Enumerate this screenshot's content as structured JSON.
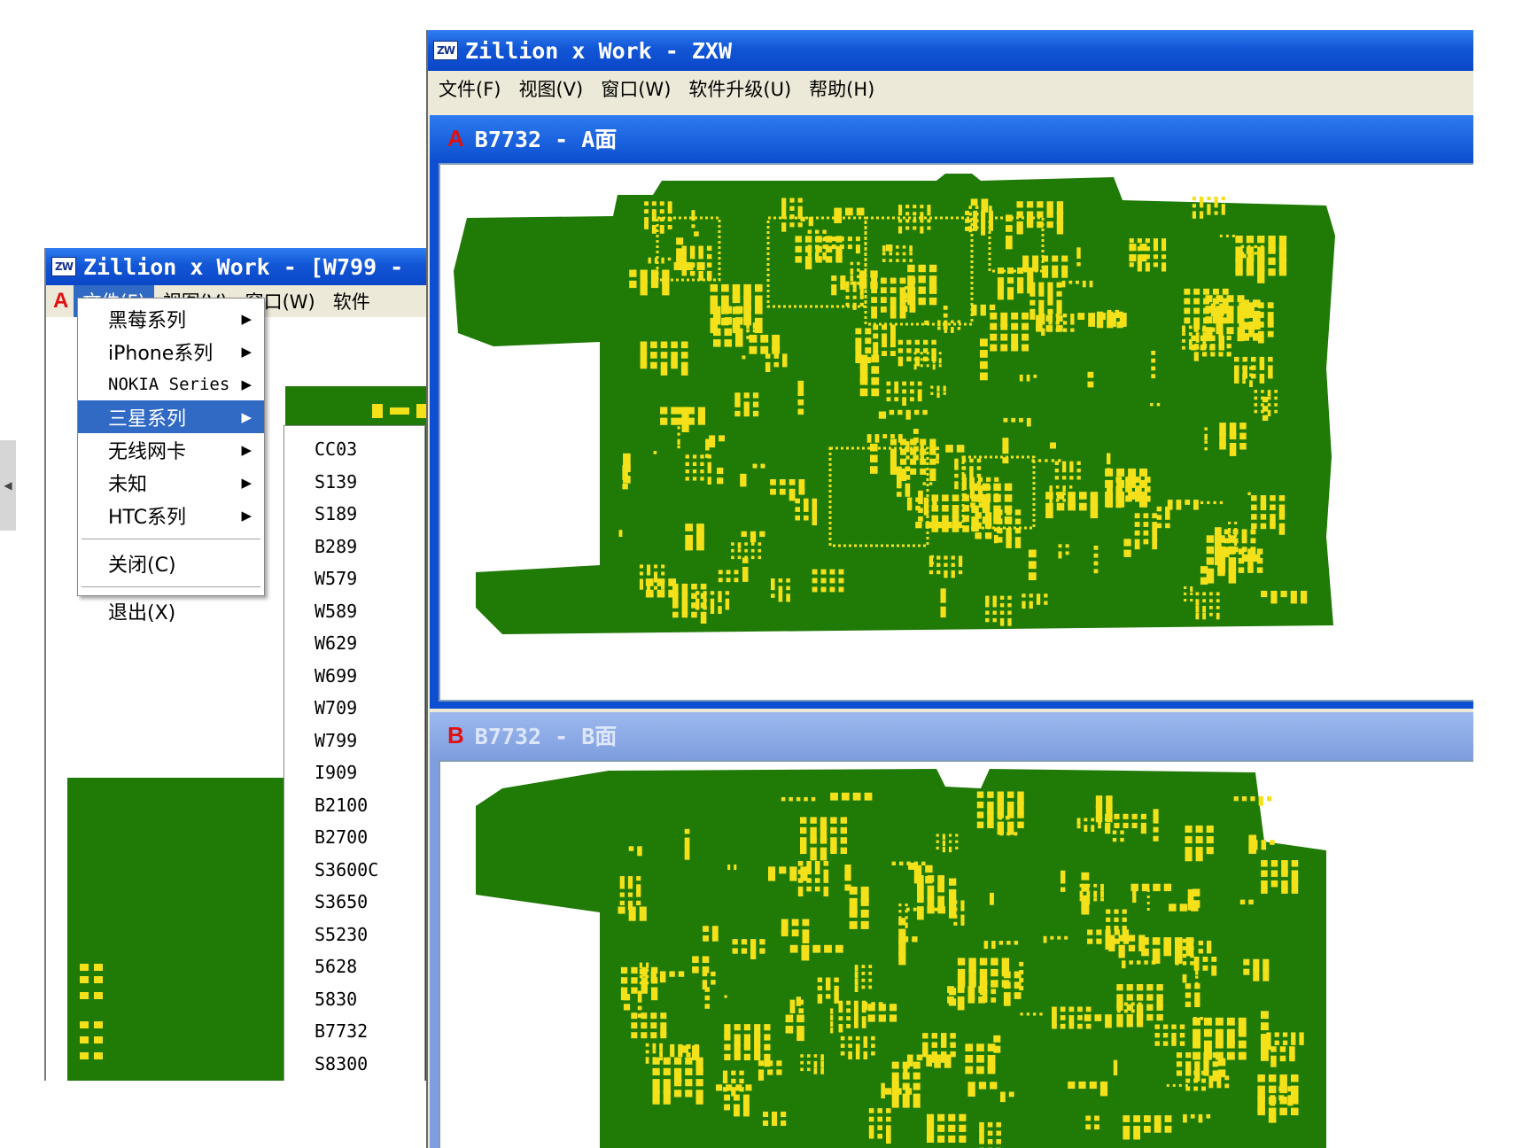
{
  "left_window": {
    "title": "Zillion x Work - [W799 -",
    "icon": "ZW",
    "mdi_icon": "A",
    "menu": [
      "文件(F)",
      "视图(V)",
      "窗口(W)",
      "软件"
    ],
    "file_menu": {
      "items": [
        {
          "label": "黑莓系列",
          "submenu": true
        },
        {
          "label": "iPhone系列",
          "submenu": true
        },
        {
          "label": "NOKIA Series",
          "submenu": true
        },
        {
          "label": "三星系列",
          "submenu": true,
          "highlighted": true
        },
        {
          "label": "无线网卡",
          "submenu": true
        },
        {
          "label": "未知",
          "submenu": true
        },
        {
          "label": "HTC系列",
          "submenu": true
        }
      ],
      "close_label": "关闭(C)",
      "exit_label": "退出(X)"
    },
    "samsung_submenu": [
      "CC03",
      "S139",
      "S189",
      "B289",
      "W579",
      "W589",
      "W629",
      "W699",
      "W709",
      "W799",
      "I909",
      "B2100",
      "B2700",
      "S3600C",
      "S3650",
      "S5230",
      "5628",
      "5830",
      "B7732",
      "S8300"
    ]
  },
  "right_window": {
    "title": "Zillion x Work - ZXW",
    "icon": "ZW",
    "menu": [
      "文件(F)",
      "视图(V)",
      "窗口(W)",
      "软件升级(U)",
      "帮助(H)"
    ],
    "child_a": {
      "icon": "A",
      "title": "B7732 - A面"
    },
    "child_b": {
      "icon": "B",
      "title": "B7732 - B面"
    }
  },
  "colors": {
    "board": "#1f7a06",
    "pad": "#f4e11a",
    "titlebar": "#0a47c8",
    "highlight": "#316ac5"
  }
}
